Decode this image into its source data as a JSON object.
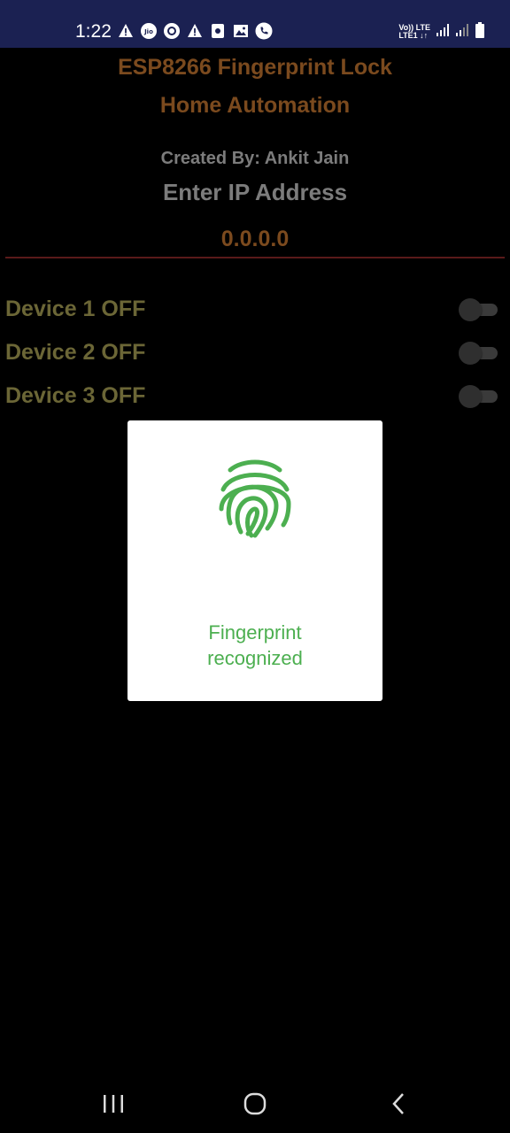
{
  "status_bar": {
    "time": "1:22",
    "network_label_top": "Vo)) LTE",
    "network_label_bottom": "LTE1 ↓↑",
    "left_icons": [
      "warning-icon",
      "jio-icon",
      "circle-icon",
      "warning-icon",
      "sim-icon",
      "image-icon",
      "phone-icon"
    ],
    "right_icons": [
      "signal-icon",
      "signal-icon",
      "battery-icon"
    ]
  },
  "app": {
    "title_line1": "ESP8266 Fingerprint Lock",
    "title_line2": "Home Automation",
    "credit": "Created By: Ankit Jain",
    "ip_label": "Enter IP Address",
    "ip_value": "0.0.0.0",
    "devices": [
      {
        "label": "Device 1 OFF",
        "on": false
      },
      {
        "label": "Device 2 OFF",
        "on": false
      },
      {
        "label": "Device 3 OFF",
        "on": false
      }
    ]
  },
  "dialog": {
    "icon": "fingerprint-icon",
    "message_line1": "Fingerprint",
    "message_line2": "recognized"
  },
  "nav_bar": {
    "buttons": [
      "recent-apps-icon",
      "home-icon",
      "back-icon"
    ]
  },
  "colors": {
    "status_bar_bg": "#1b2152",
    "title": "#7b4a1e",
    "credit": "#7c7c7c",
    "device_label": "#6b6636",
    "underline": "#5a1a1a",
    "dialog_accent": "#4caf50"
  }
}
